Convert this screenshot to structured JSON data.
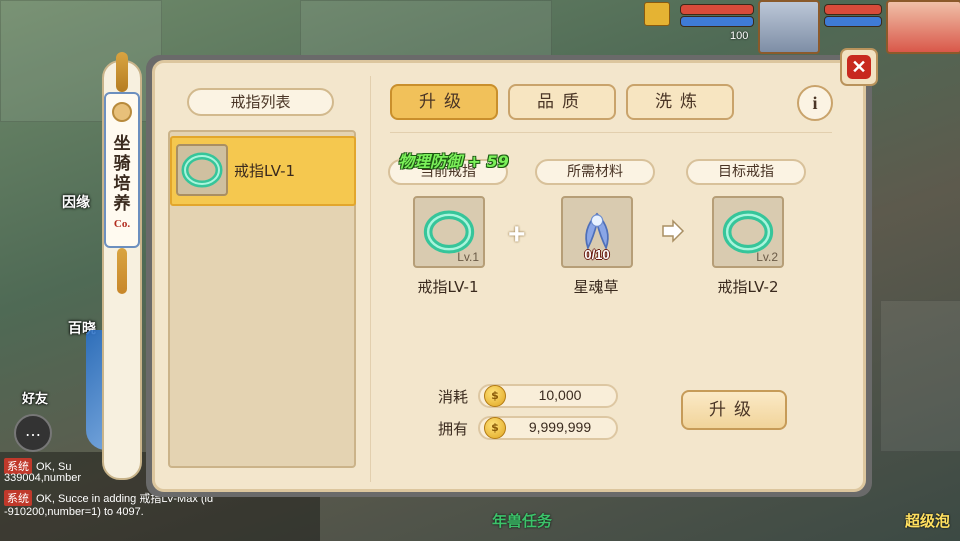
{
  "scroll_tab": {
    "label": "坐骑培养",
    "seal": "Co."
  },
  "list": {
    "title": "戒指列表",
    "items": [
      {
        "label": "戒指LV-1"
      }
    ]
  },
  "tabs": [
    {
      "label": "升级",
      "active": true
    },
    {
      "label": "品质",
      "active": false
    },
    {
      "label": "洗炼",
      "active": false
    }
  ],
  "info_button": "i",
  "attribute_popup": "物理防御 + 59",
  "sections": {
    "current": "当前戒指",
    "material": "所需材料",
    "target": "目标戒指"
  },
  "slots": {
    "current": {
      "level_badge": "Lv.1",
      "name": "戒指LV-1"
    },
    "material": {
      "count": "0/10",
      "name": "星魂草"
    },
    "target": {
      "level_badge": "Lv.2",
      "name": "戒指LV-2"
    }
  },
  "costs": {
    "consume_label": "消耗",
    "consume_value": "10,000",
    "own_label": "拥有",
    "own_value": "9,999,999"
  },
  "upgrade_button": "升级",
  "close_button": "✕",
  "hud": {
    "value": "100"
  },
  "background_text": {
    "side1": "因缘",
    "side2": "百晓",
    "friends": "好友",
    "task": "年兽任务",
    "bottom_right": "超级泡",
    "chat_line1_tag": "系统",
    "chat_line1": "OK, Su",
    "chat_line2": "339004,number",
    "chat_line3_tag": "系统",
    "chat_line3": "OK, Succe      in adding 戒指LV-Max (id",
    "chat_line4": "-910200,number=1) to 4097."
  },
  "colors": {
    "panel_bg": "#f3e6cc",
    "active_tab": "#f1c15a",
    "selected_item": "#f5c84f",
    "close_red": "#c8291f",
    "attribute_green": "#7bf05a"
  }
}
